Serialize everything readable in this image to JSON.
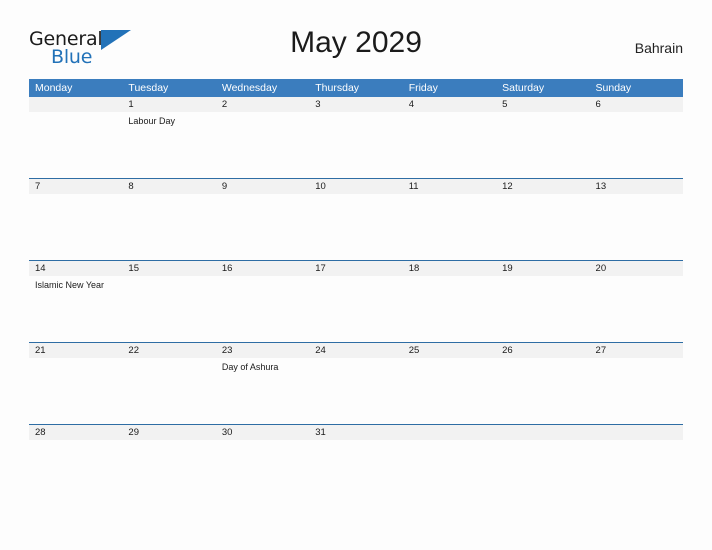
{
  "brand": {
    "name_part1": "General",
    "name_part2": "Blue",
    "mark_icon": "blue-triangle-icon",
    "accent_color": "#2272b8"
  },
  "header": {
    "title": "May 2029",
    "country": "Bahrain"
  },
  "theme": {
    "header_blue": "#3b7dbe",
    "divider_blue": "#2e6da4",
    "daynum_background": "#f2f2f2",
    "page_background": "#fdfdfd",
    "text_color": "#1b1b1b"
  },
  "calendar": {
    "weekdays": [
      "Monday",
      "Tuesday",
      "Wednesday",
      "Thursday",
      "Friday",
      "Saturday",
      "Sunday"
    ],
    "weeks": [
      {
        "days": [
          {
            "num": "",
            "event": ""
          },
          {
            "num": "1",
            "event": "Labour Day"
          },
          {
            "num": "2",
            "event": ""
          },
          {
            "num": "3",
            "event": ""
          },
          {
            "num": "4",
            "event": ""
          },
          {
            "num": "5",
            "event": ""
          },
          {
            "num": "6",
            "event": ""
          }
        ]
      },
      {
        "days": [
          {
            "num": "7",
            "event": ""
          },
          {
            "num": "8",
            "event": ""
          },
          {
            "num": "9",
            "event": ""
          },
          {
            "num": "10",
            "event": ""
          },
          {
            "num": "11",
            "event": ""
          },
          {
            "num": "12",
            "event": ""
          },
          {
            "num": "13",
            "event": ""
          }
        ]
      },
      {
        "days": [
          {
            "num": "14",
            "event": "Islamic New Year"
          },
          {
            "num": "15",
            "event": ""
          },
          {
            "num": "16",
            "event": ""
          },
          {
            "num": "17",
            "event": ""
          },
          {
            "num": "18",
            "event": ""
          },
          {
            "num": "19",
            "event": ""
          },
          {
            "num": "20",
            "event": ""
          }
        ]
      },
      {
        "days": [
          {
            "num": "21",
            "event": ""
          },
          {
            "num": "22",
            "event": ""
          },
          {
            "num": "23",
            "event": "Day of Ashura"
          },
          {
            "num": "24",
            "event": ""
          },
          {
            "num": "25",
            "event": ""
          },
          {
            "num": "26",
            "event": ""
          },
          {
            "num": "27",
            "event": ""
          }
        ]
      },
      {
        "days": [
          {
            "num": "28",
            "event": ""
          },
          {
            "num": "29",
            "event": ""
          },
          {
            "num": "30",
            "event": ""
          },
          {
            "num": "31",
            "event": ""
          },
          {
            "num": "",
            "event": ""
          },
          {
            "num": "",
            "event": ""
          },
          {
            "num": "",
            "event": ""
          }
        ]
      }
    ]
  }
}
